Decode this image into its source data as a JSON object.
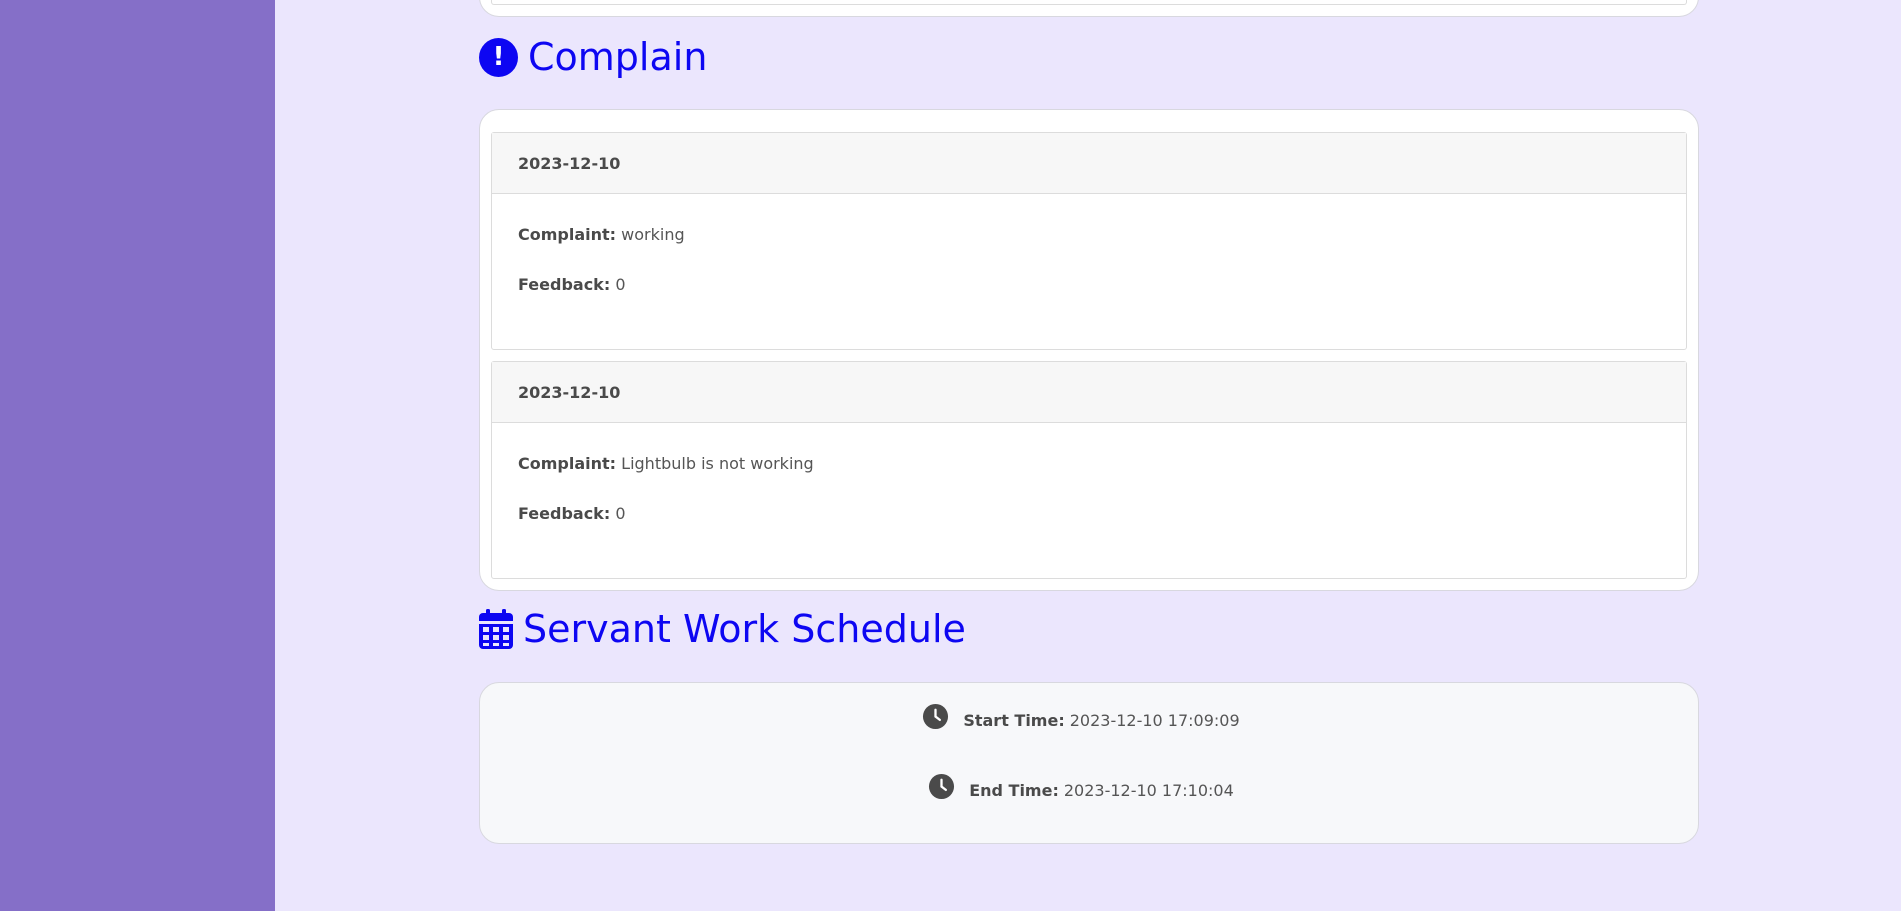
{
  "complain": {
    "title": "Complain",
    "entries": [
      {
        "date": "2023-12-10",
        "complaint_label": "Complaint:",
        "complaint": "working",
        "feedback_label": "Feedback:",
        "feedback": "0"
      },
      {
        "date": "2023-12-10",
        "complaint_label": "Complaint:",
        "complaint": "Lightbulb is not working",
        "feedback_label": "Feedback:",
        "feedback": "0"
      }
    ]
  },
  "schedule": {
    "title": "Servant Work Schedule",
    "start_label": "Start Time:",
    "start_value": "2023-12-10 17:09:09",
    "end_label": "End Time:",
    "end_value": "2023-12-10 17:10:04"
  },
  "colors": {
    "sidebar": "#856fc8",
    "page_background": "#ebe6fd",
    "heading_accent": "#0d06f2"
  },
  "icons": [
    "exclamation-circle-icon",
    "calendar-icon",
    "clock-icon"
  ]
}
